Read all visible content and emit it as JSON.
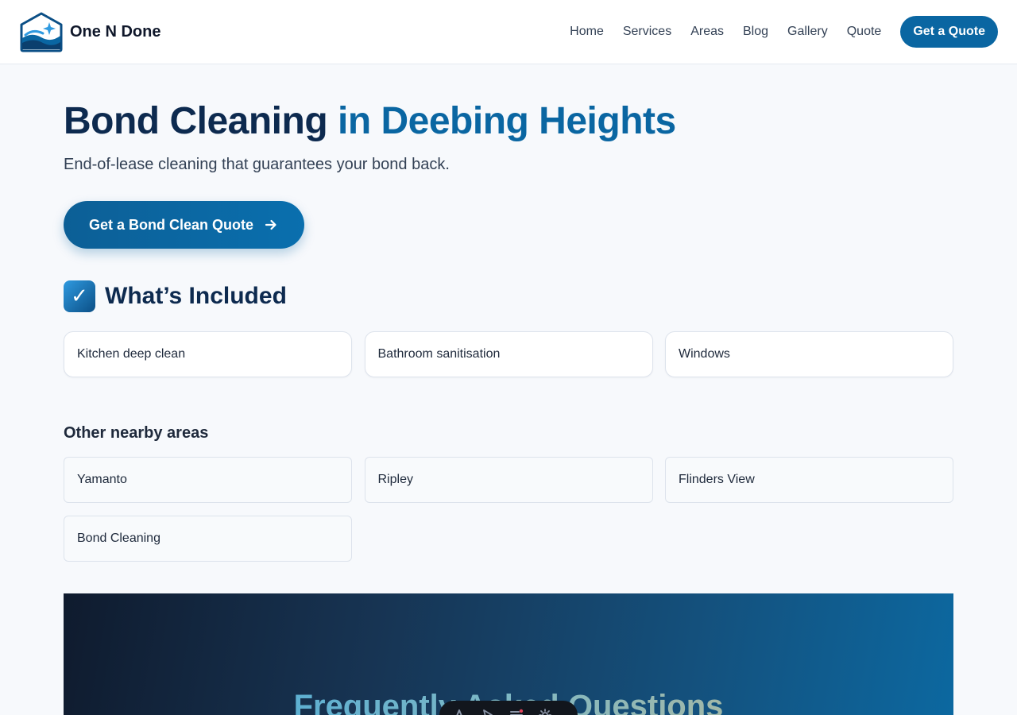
{
  "header": {
    "brand_name": "One N Done",
    "nav": [
      "Home",
      "Services",
      "Areas",
      "Blog",
      "Gallery",
      "Quote"
    ],
    "cta_label": "Get a Quote"
  },
  "hero": {
    "title_main": "Bond Cleaning",
    "title_location": "in Deebing Heights",
    "subtitle": "End-of-lease cleaning that guarantees your bond back.",
    "cta_label": "Get a Bond Clean Quote"
  },
  "included": {
    "title": "What’s Included",
    "check_glyph": "✓",
    "items": [
      "Kitchen deep clean",
      "Bathroom sanitisation",
      "Windows"
    ]
  },
  "nearby": {
    "title": "Other nearby areas",
    "items": [
      "Yamanto",
      "Ripley",
      "Flinders View",
      "Bond Cleaning"
    ]
  },
  "faq": {
    "title": "Frequently Asked Questions"
  },
  "toolbar": {
    "icons": [
      "text-icon",
      "pointer-icon",
      "menu-icon",
      "settings-icon"
    ]
  },
  "colors": {
    "brand_blue": "#0a66a2",
    "navy": "#0d2a4f",
    "page_bg": "#f7f9fc"
  }
}
